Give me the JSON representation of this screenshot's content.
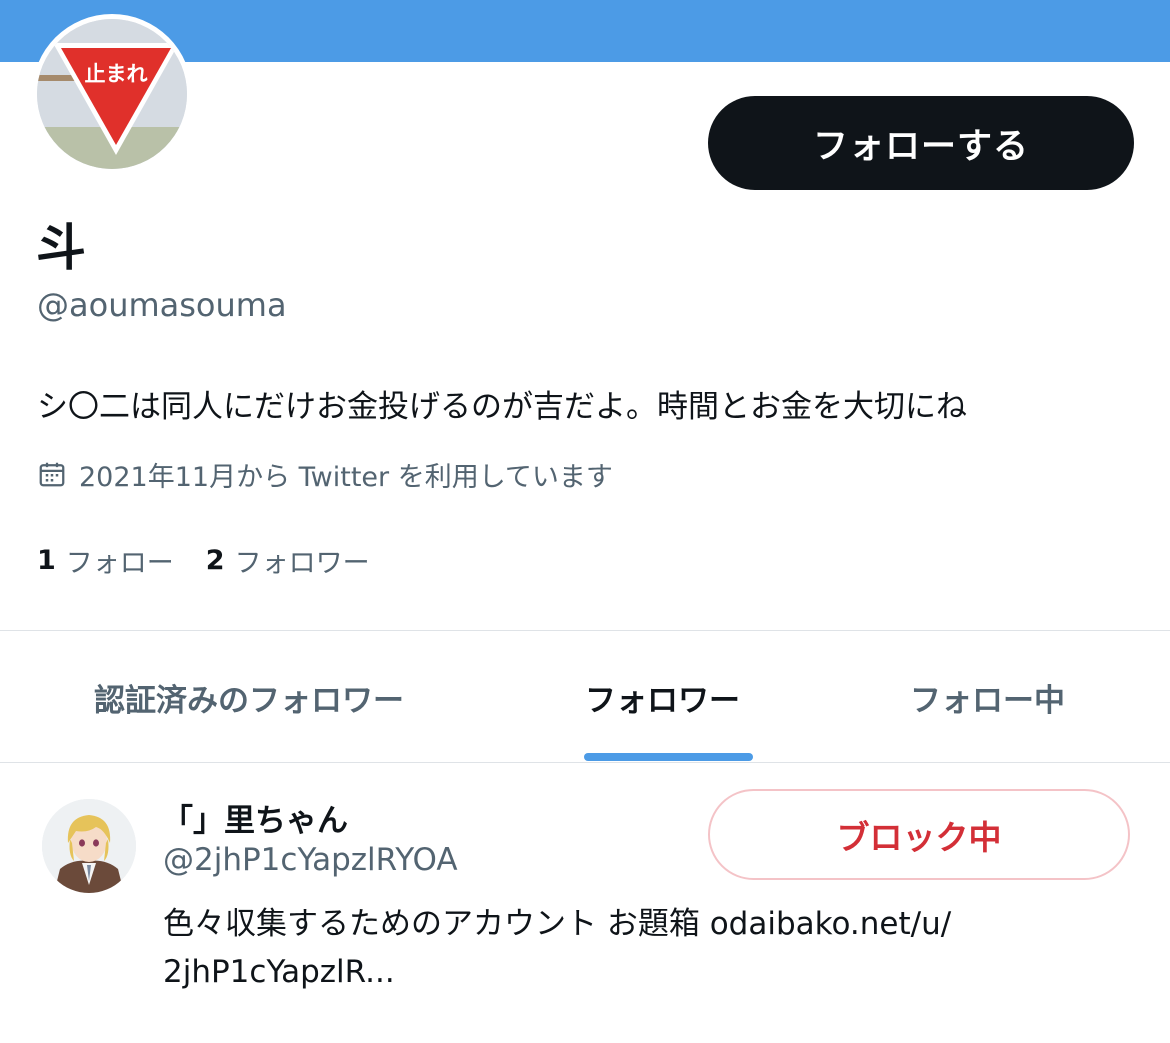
{
  "profile": {
    "follow_button": "フォローする",
    "display_name": "斗",
    "handle": "@aoumasouma",
    "bio": "シ〇二は同人にだけお金投げるのが吉だよ。時間とお金を大切にね",
    "joined": "2021年11月から Twitter を利用しています",
    "following_count": "1",
    "following_label": "フォロー",
    "followers_count": "2",
    "followers_label": "フォロワー",
    "avatar_sign_text": "止まれ"
  },
  "tabs": [
    {
      "label": "認証済みのフォロワー"
    },
    {
      "label": "フォロワー"
    },
    {
      "label": "フォロー中"
    }
  ],
  "active_tab": 1,
  "user": {
    "name": "「」里ちゃん",
    "handle": "@2jhP1cYapzlRYOA",
    "block_button": "ブロック中",
    "bio_line1": "色々収集するためのアカウント お題箱 odaibako.net/u/",
    "bio_line2": "2jhP1cYapzlR..."
  },
  "colors": {
    "banner": "#4c9be6",
    "accent": "#4c9be6",
    "block_red": "#d32f37",
    "secondary_text": "#536471"
  },
  "icons": {
    "calendar": "calendar-icon"
  }
}
